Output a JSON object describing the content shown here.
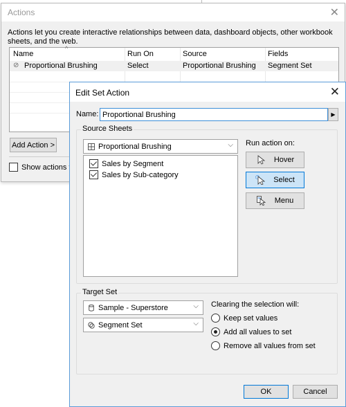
{
  "actions_dialog": {
    "title": "Actions",
    "description": "Actions let you create interactive relationships between data, dashboard objects, other workbook sheets, and the web.",
    "table": {
      "columns": [
        "Name",
        "Run On",
        "Source",
        "Fields"
      ],
      "rows": [
        {
          "name": "Proportional Brushing",
          "run_on": "Select",
          "source": "Proportional Brushing",
          "fields": "Segment Set",
          "icon": "set-action-icon"
        }
      ]
    },
    "add_action_label": "Add Action >",
    "show_actions_label": "Show actions for",
    "show_actions_checked": false
  },
  "edit_dialog": {
    "title": "Edit Set Action",
    "name_label": "Name:",
    "name_value": "Proportional Brushing",
    "source_sheets": {
      "label": "Source Sheets",
      "dashboard": "Proportional Brushing",
      "sheets": [
        {
          "label": "Sales by Segment",
          "checked": true
        },
        {
          "label": "Sales by Sub-category",
          "checked": true
        }
      ]
    },
    "run_action_on": {
      "label": "Run action on:",
      "options": [
        {
          "label": "Hover",
          "icon": "hover-cursor-icon",
          "selected": false
        },
        {
          "label": "Select",
          "icon": "select-cursor-icon",
          "selected": true
        },
        {
          "label": "Menu",
          "icon": "menu-cursor-icon",
          "selected": false
        }
      ]
    },
    "target_set": {
      "label": "Target Set",
      "data_source": "Sample - Superstore",
      "set": "Segment Set"
    },
    "clearing": {
      "label": "Clearing the selection will:",
      "options": [
        {
          "label": "Keep set values",
          "selected": false
        },
        {
          "label": "Add all values to set",
          "selected": true
        },
        {
          "label": "Remove all values from set",
          "selected": false
        }
      ]
    },
    "ok_label": "OK",
    "cancel_label": "Cancel"
  }
}
